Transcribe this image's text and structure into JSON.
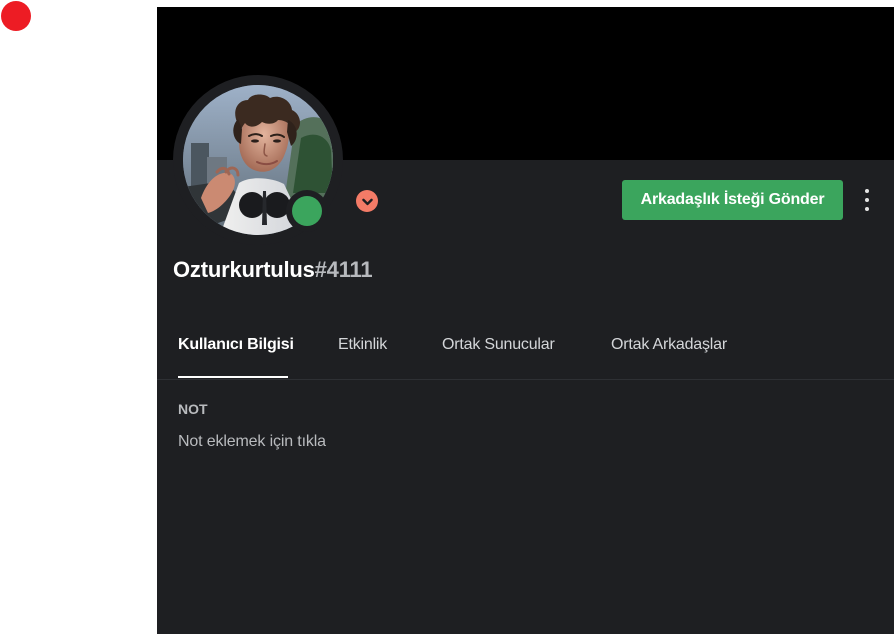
{
  "screen": {
    "indicator_color": "#ed1c24"
  },
  "profile": {
    "username": "Ozturkurtulus",
    "discriminator": "#4111",
    "status": "online",
    "status_color": "#3ba55d",
    "badge_icon": "chevron-down-icon",
    "badge_color": "#f47b67",
    "avatar_alt": "profile avatar"
  },
  "actions": {
    "friend_request_label": "Arkadaşlık İsteği Gönder",
    "friend_request_color": "#3ba55d",
    "more_icon": "more-vertical-icon"
  },
  "tabs": [
    {
      "label": "Kullanıcı Bilgisi",
      "active": true
    },
    {
      "label": "Etkinlik",
      "active": false
    },
    {
      "label": "Ortak Sunucular",
      "active": false
    },
    {
      "label": "Ortak Arkadaşlar",
      "active": false
    }
  ],
  "note": {
    "heading": "NOT",
    "placeholder": "Not eklemek için tıkla"
  },
  "colors": {
    "banner": "#000000",
    "panel": "#1e1f22",
    "text_primary": "#ffffff",
    "text_secondary": "#b9bbbe"
  }
}
